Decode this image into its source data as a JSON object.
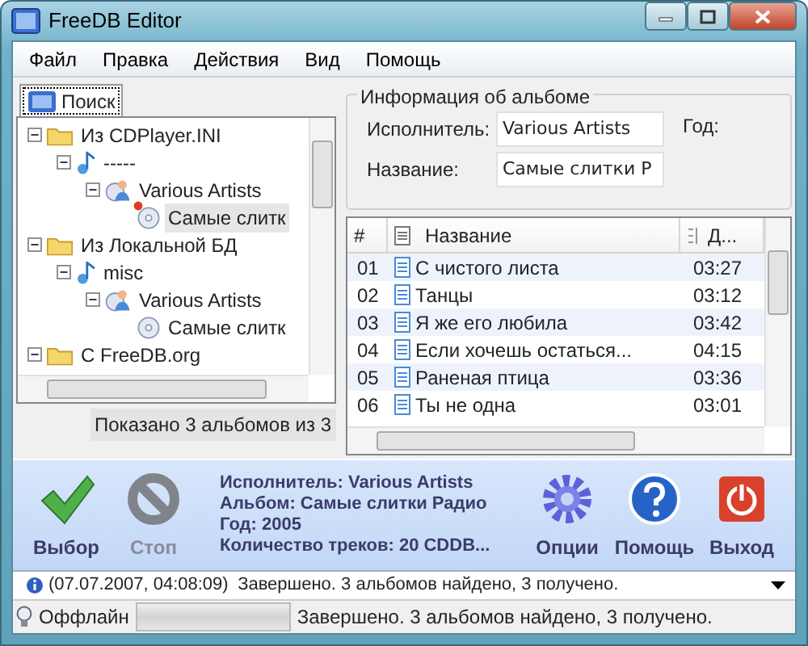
{
  "window": {
    "title": "FreeDB Editor"
  },
  "menu": [
    "Файл",
    "Правка",
    "Действия",
    "Вид",
    "Помощь"
  ],
  "search_tab": {
    "label": "Поиск",
    "selected": true
  },
  "tree": [
    {
      "kind": "folder",
      "label": "Из CDPlayer.INI",
      "expanded": true,
      "selected": false,
      "children": [
        {
          "kind": "genre",
          "label": "-----",
          "expanded": true,
          "selected": false,
          "children": [
            {
              "kind": "artist",
              "label": "Various Artists",
              "expanded": true,
              "selected": false,
              "children": [
                {
                  "kind": "album",
                  "label": "Самые слитк",
                  "selected": true,
                  "marked": true
                }
              ]
            }
          ]
        }
      ]
    },
    {
      "kind": "folder",
      "label": "Из Локальной БД",
      "expanded": true,
      "selected": false,
      "children": [
        {
          "kind": "genre",
          "label": "misc",
          "expanded": true,
          "selected": false,
          "children": [
            {
              "kind": "artist",
              "label": "Various Artists",
              "expanded": true,
              "selected": false,
              "children": [
                {
                  "kind": "album",
                  "label": "Самые слитк",
                  "selected": false,
                  "marked": false
                }
              ]
            }
          ]
        }
      ]
    },
    {
      "kind": "folder",
      "label": "С FreeDB.org",
      "expanded": true,
      "selected": false
    }
  ],
  "tree_status": "Показано 3 альбомов из 3",
  "album_info": {
    "title": "Информация об альбоме",
    "artist_label": "Исполнитель:",
    "artist_value": "Various Artists",
    "name_label": "Название:",
    "name_value": "Самые слитки Р",
    "year_label": "Год:"
  },
  "tracks": {
    "columns": [
      "#",
      "Название",
      "Д..."
    ],
    "rows": [
      {
        "num": "01",
        "title": "С чистого листа",
        "duration": "03:27"
      },
      {
        "num": "02",
        "title": "Танцы",
        "duration": "03:12"
      },
      {
        "num": "03",
        "title": "Я же его любила",
        "duration": "03:42"
      },
      {
        "num": "04",
        "title": "Если хочешь остаться...",
        "duration": "04:15"
      },
      {
        "num": "05",
        "title": "Раненая птица",
        "duration": "03:36"
      },
      {
        "num": "06",
        "title": "Ты не одна",
        "duration": "03:01"
      }
    ]
  },
  "toolbar_left": [
    {
      "kind": "select",
      "label": "Выбор",
      "disabled": false
    },
    {
      "kind": "stop",
      "label": "Стоп",
      "disabled": true
    }
  ],
  "summary": [
    "Исполнитель: Various Artists",
    "Альбом: Самые слитки Радио",
    "Год: 2005",
    "Количество треков: 20 CDDB..."
  ],
  "toolbar_right": [
    {
      "kind": "options",
      "label": "Опции",
      "disabled": false
    },
    {
      "kind": "help",
      "label": "Помощь",
      "disabled": false
    },
    {
      "kind": "exit",
      "label": "Выход",
      "disabled": false
    }
  ],
  "log": {
    "time": "(07.07.2007, 04:08:09)",
    "message": "Завершено. 3 альбомов найдено, 3 получено."
  },
  "status_bar": {
    "mode": "Оффлайн",
    "progress": {
      "level": 0
    },
    "message": "Завершено. 3 альбомов найдено, 3 получено."
  }
}
